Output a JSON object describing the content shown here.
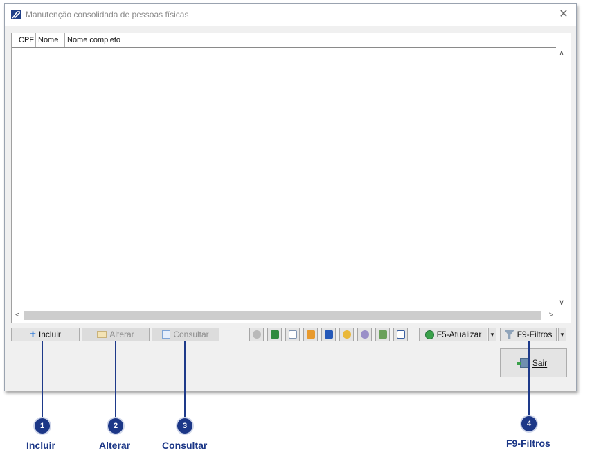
{
  "window": {
    "title": "Manutenção consolidada de pessoas físicas"
  },
  "grid": {
    "columns": [
      "CPF",
      "Nome",
      "Nome completo"
    ]
  },
  "buttons": {
    "incluir": "Incluir",
    "alterar": "Alterar",
    "consultar": "Consultar",
    "atualizar": "F5-Atualizar",
    "filtros": "F9-Filtros",
    "sair": "Sair"
  },
  "toolbar_icons": [
    "binoculars-icon",
    "excel-icon",
    "document-icon",
    "table-icon",
    "sort-icon",
    "palette-icon",
    "gear-icon",
    "print-icon",
    "checklist-icon"
  ],
  "callouts": [
    {
      "number": "1",
      "label": "Incluir"
    },
    {
      "number": "2",
      "label": "Alterar"
    },
    {
      "number": "3",
      "label": "Consultar"
    },
    {
      "number": "4",
      "label": "F9-Filtros"
    }
  ],
  "colors": {
    "accent": "#1c3787",
    "window_bg": "#f0f0f0",
    "button_bg": "#e4e4e4"
  }
}
